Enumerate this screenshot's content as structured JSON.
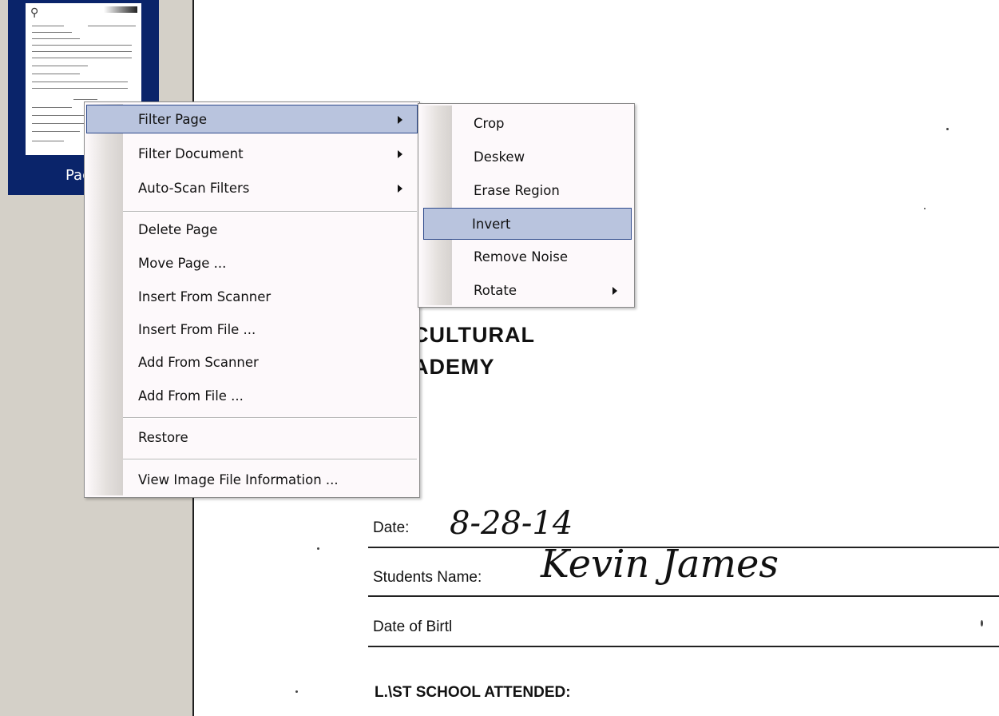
{
  "sidebar": {
    "thumbnail_label": "Pag"
  },
  "context_menu": {
    "items": [
      {
        "label": "Filter Page",
        "submenu": true,
        "highlighted": true
      },
      {
        "label": "Filter Document",
        "submenu": true
      },
      {
        "label": "Auto-Scan Filters",
        "submenu": true
      },
      {
        "label": "Delete Page"
      },
      {
        "label": "Move Page ..."
      },
      {
        "label": "Insert From Scanner"
      },
      {
        "label": "Insert From File ..."
      },
      {
        "label": "Add From Scanner"
      },
      {
        "label": "Add From File ..."
      },
      {
        "label": "Restore"
      },
      {
        "label": "View Image File Information ..."
      }
    ]
  },
  "filter_submenu": {
    "items": [
      {
        "label": "Crop"
      },
      {
        "label": "Deskew"
      },
      {
        "label": "Erase Region"
      },
      {
        "label": "Invert",
        "highlighted": true
      },
      {
        "label": "Remove Noise"
      },
      {
        "label": "Rotate",
        "submenu": true
      }
    ]
  },
  "document": {
    "heading_line1": "CULTURAL",
    "heading_line2": "ADEMY",
    "date_label": "Date:",
    "date_value": "8-28-14",
    "student_label": "Students Name:",
    "student_value": "Kevin James",
    "dob_label": "Date of Birtl",
    "last_school_label": "L.\\ST SCHOOL ATTENDED:"
  },
  "colors": {
    "sidebar_bg": "#d4d0c8",
    "thumb_selected": "#0a246a",
    "menu_bg": "#fdf9fb",
    "highlight_bg": "#b9c4de",
    "highlight_border": "#2e4a8c"
  }
}
